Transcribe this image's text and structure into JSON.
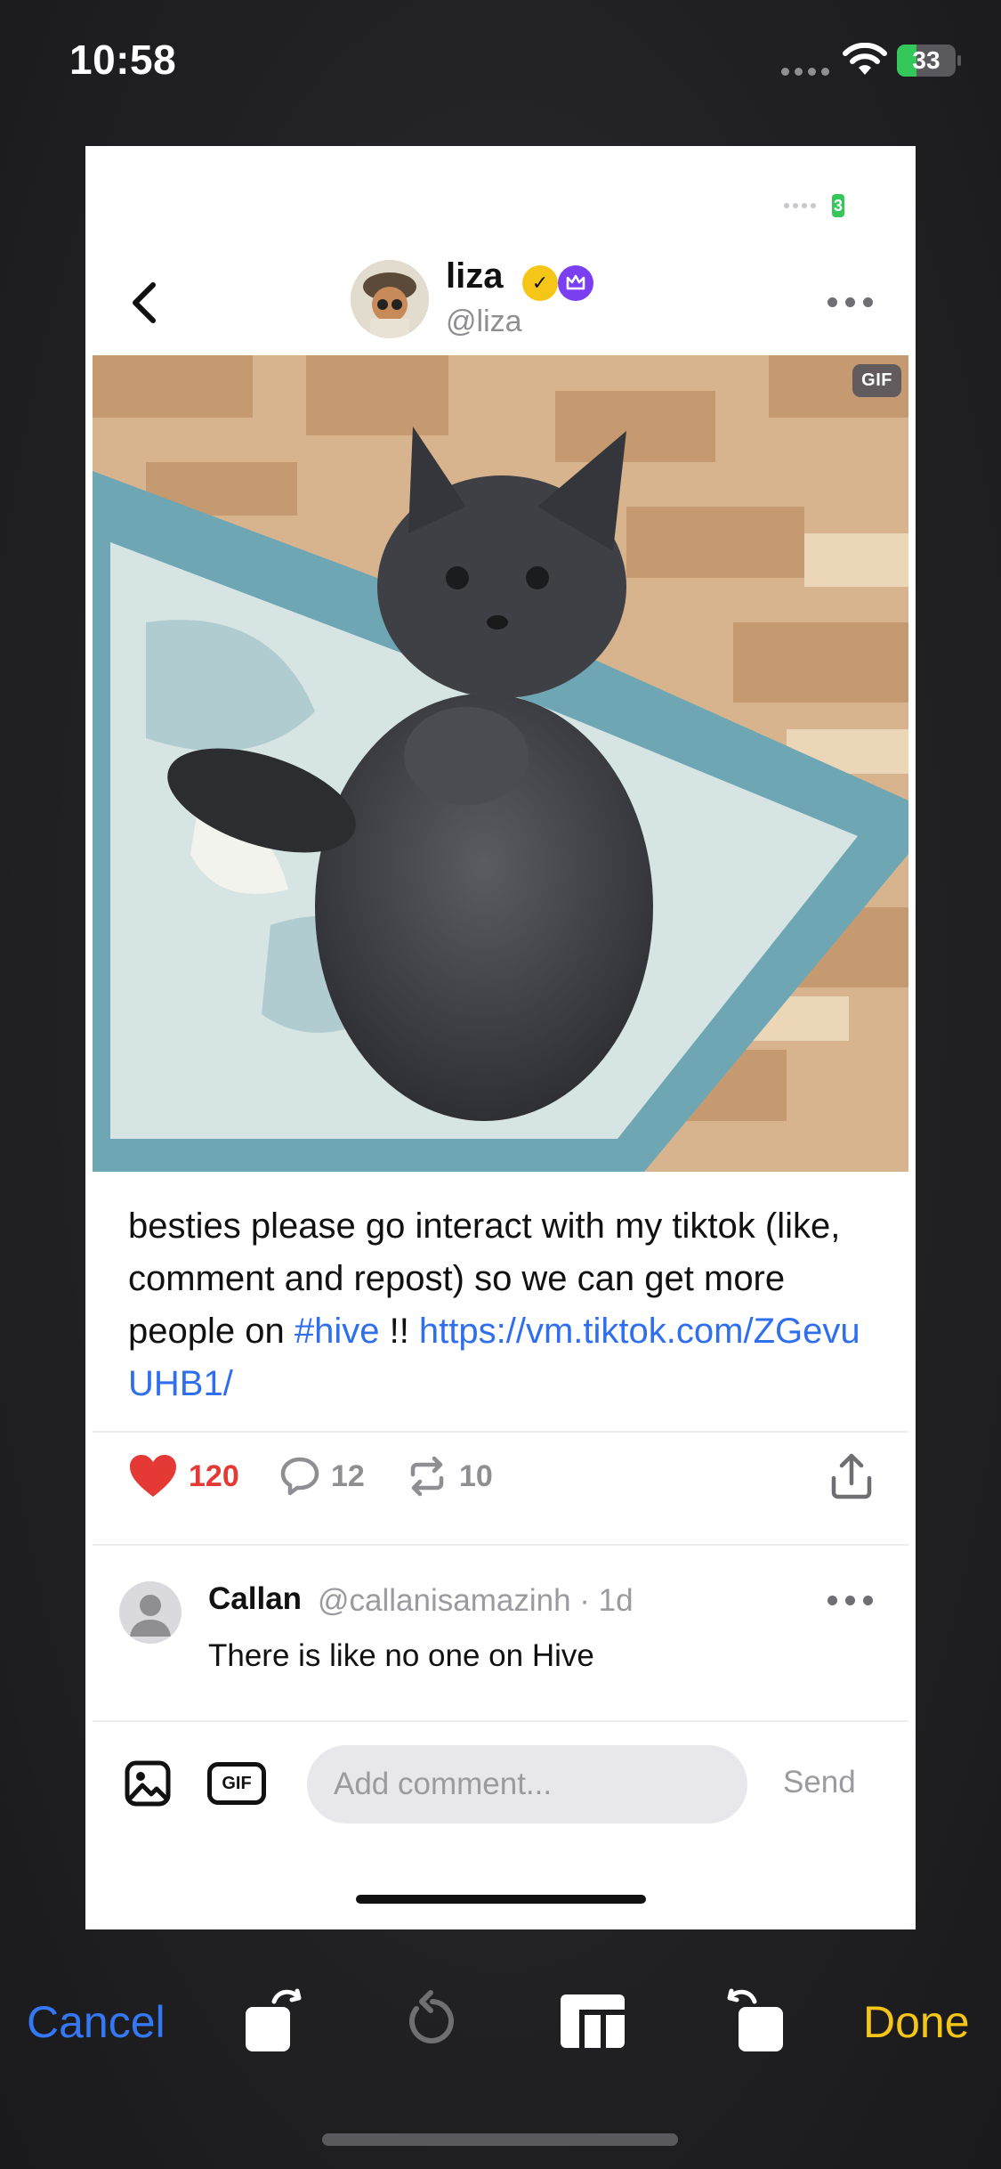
{
  "status_bar": {
    "time": "10:58",
    "battery": "33",
    "battery_level": 0.33
  },
  "inner_status": {
    "battery": "3"
  },
  "post": {
    "name": "liza",
    "handle": "@liza",
    "media_badge": "GIF",
    "text_main": "besties please go interact with my tiktok (like, comment and repost) so we can get more people on ",
    "hashtag": "#hive",
    "text_after_tag": " !! ",
    "link": "https://vm.tiktok.com/ZGevuUHB1/",
    "likes": "120",
    "comments": "12",
    "reposts": "10",
    "colors": {
      "accent": "#2f6fed",
      "like": "#e53935",
      "verified": "#f5c518",
      "crown": "#7b3ff2"
    }
  },
  "comment": {
    "name": "Callan",
    "meta": "@callanisamazinh · 1d",
    "text": "There is like no one on Hive"
  },
  "composer": {
    "gif_label": "GIF",
    "placeholder": "Add comment...",
    "send_label": "Send"
  },
  "toolbar": {
    "cancel_label": "Cancel",
    "done_label": "Done",
    "colors": {
      "cancel": "#3478f6",
      "done": "#f5c518"
    },
    "icons": [
      "rotate-left-icon",
      "reset-rotation-icon",
      "aspect-ratio-icon",
      "rotate-right-icon"
    ]
  }
}
